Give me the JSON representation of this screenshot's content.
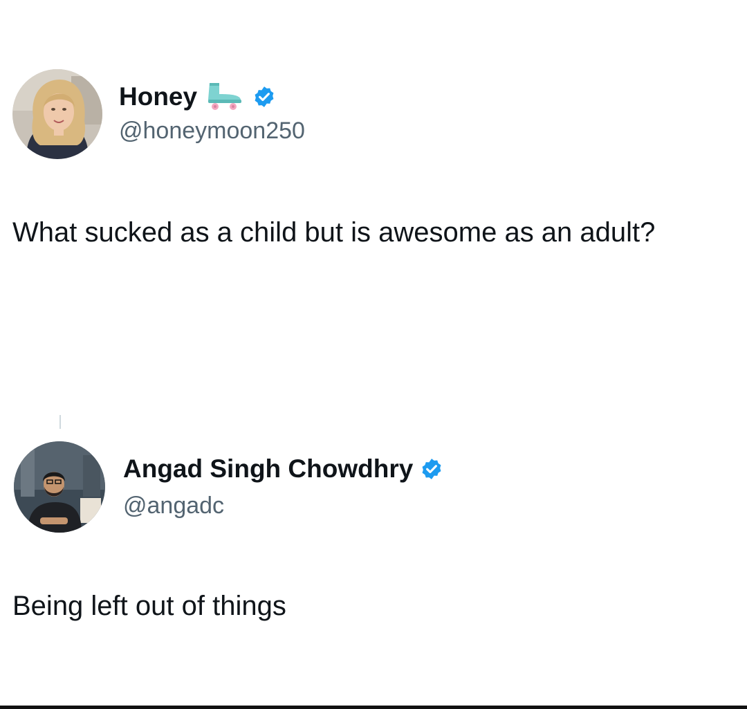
{
  "tweets": [
    {
      "display_name": "Honey",
      "handle": "@honeymoon250",
      "verified": true,
      "name_emoji": "roller-skate-icon",
      "text": "What sucked as a child but is awesome as an adult?"
    },
    {
      "display_name": "Angad Singh Chowdhry",
      "handle": "@angadc",
      "verified": true,
      "text": "Being left out of things"
    }
  ],
  "colors": {
    "verified_blue": "#1d9bf0",
    "handle_gray": "#536471",
    "text": "#0f1419",
    "skate_teal": "#7ed3d1",
    "skate_pink": "#f4a7c0"
  }
}
